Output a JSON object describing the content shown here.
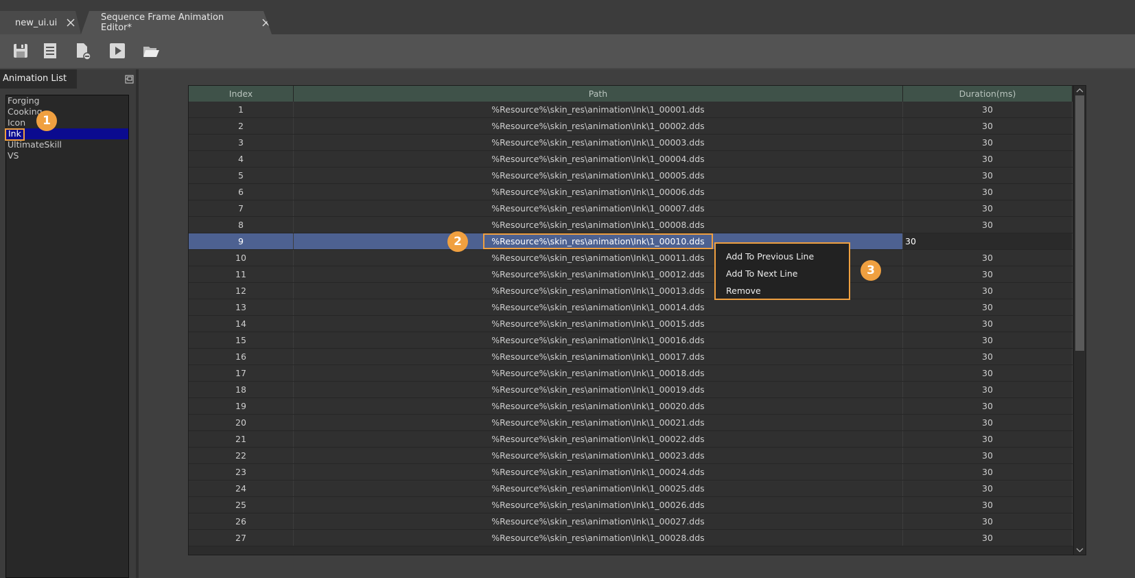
{
  "tabs": [
    {
      "label": "new_ui.ui",
      "close_icon": "close-icon"
    },
    {
      "label": "Sequence Frame Animation Editor*",
      "close_icon": "close-icon"
    }
  ],
  "toolbar": {
    "buttons": [
      {
        "icon": "save-icon"
      },
      {
        "icon": "list-icon"
      },
      {
        "icon": "file-remove-icon"
      },
      {
        "icon": "play-icon"
      },
      {
        "icon": "folder-open-icon"
      }
    ]
  },
  "animation_list": {
    "title": "Animation List",
    "items": [
      "Forging",
      "Cooking",
      "Icon",
      "Ink",
      "UltimateSkill",
      "VS"
    ],
    "selected": "Ink"
  },
  "table": {
    "headers": [
      "Index",
      "Path",
      "Duration(ms)"
    ],
    "rows": [
      {
        "index": "1",
        "path": "%Resource%\\skin_res\\animation\\Ink\\1_00001.dds",
        "duration": "30"
      },
      {
        "index": "2",
        "path": "%Resource%\\skin_res\\animation\\Ink\\1_00002.dds",
        "duration": "30"
      },
      {
        "index": "3",
        "path": "%Resource%\\skin_res\\animation\\Ink\\1_00003.dds",
        "duration": "30"
      },
      {
        "index": "4",
        "path": "%Resource%\\skin_res\\animation\\Ink\\1_00004.dds",
        "duration": "30"
      },
      {
        "index": "5",
        "path": "%Resource%\\skin_res\\animation\\Ink\\1_00005.dds",
        "duration": "30"
      },
      {
        "index": "6",
        "path": "%Resource%\\skin_res\\animation\\Ink\\1_00006.dds",
        "duration": "30"
      },
      {
        "index": "7",
        "path": "%Resource%\\skin_res\\animation\\Ink\\1_00007.dds",
        "duration": "30"
      },
      {
        "index": "8",
        "path": "%Resource%\\skin_res\\animation\\Ink\\1_00008.dds",
        "duration": "30"
      },
      {
        "index": "9",
        "path": "%Resource%\\skin_res\\animation\\Ink\\1_00010.dds",
        "duration": "30"
      },
      {
        "index": "10",
        "path": "%Resource%\\skin_res\\animation\\Ink\\1_00011.dds",
        "duration": "30"
      },
      {
        "index": "11",
        "path": "%Resource%\\skin_res\\animation\\Ink\\1_00012.dds",
        "duration": "30"
      },
      {
        "index": "12",
        "path": "%Resource%\\skin_res\\animation\\Ink\\1_00013.dds",
        "duration": "30"
      },
      {
        "index": "13",
        "path": "%Resource%\\skin_res\\animation\\Ink\\1_00014.dds",
        "duration": "30"
      },
      {
        "index": "14",
        "path": "%Resource%\\skin_res\\animation\\Ink\\1_00015.dds",
        "duration": "30"
      },
      {
        "index": "15",
        "path": "%Resource%\\skin_res\\animation\\Ink\\1_00016.dds",
        "duration": "30"
      },
      {
        "index": "16",
        "path": "%Resource%\\skin_res\\animation\\Ink\\1_00017.dds",
        "duration": "30"
      },
      {
        "index": "17",
        "path": "%Resource%\\skin_res\\animation\\Ink\\1_00018.dds",
        "duration": "30"
      },
      {
        "index": "18",
        "path": "%Resource%\\skin_res\\animation\\Ink\\1_00019.dds",
        "duration": "30"
      },
      {
        "index": "19",
        "path": "%Resource%\\skin_res\\animation\\Ink\\1_00020.dds",
        "duration": "30"
      },
      {
        "index": "20",
        "path": "%Resource%\\skin_res\\animation\\Ink\\1_00021.dds",
        "duration": "30"
      },
      {
        "index": "21",
        "path": "%Resource%\\skin_res\\animation\\Ink\\1_00022.dds",
        "duration": "30"
      },
      {
        "index": "22",
        "path": "%Resource%\\skin_res\\animation\\Ink\\1_00023.dds",
        "duration": "30"
      },
      {
        "index": "23",
        "path": "%Resource%\\skin_res\\animation\\Ink\\1_00024.dds",
        "duration": "30"
      },
      {
        "index": "24",
        "path": "%Resource%\\skin_res\\animation\\Ink\\1_00025.dds",
        "duration": "30"
      },
      {
        "index": "25",
        "path": "%Resource%\\skin_res\\animation\\Ink\\1_00026.dds",
        "duration": "30"
      },
      {
        "index": "26",
        "path": "%Resource%\\skin_res\\animation\\Ink\\1_00027.dds",
        "duration": "30"
      },
      {
        "index": "27",
        "path": "%Resource%\\skin_res\\animation\\Ink\\1_00028.dds",
        "duration": "30"
      }
    ],
    "selected_index": "9"
  },
  "context_menu": {
    "items": [
      "Add To Previous Line",
      "Add To Next Line",
      "Remove"
    ]
  },
  "callouts": [
    "1",
    "2",
    "3"
  ],
  "colors": {
    "accent_orange": "#f0a040",
    "selected_row": "#4d6191",
    "selected_list_item": "#0b0b8f",
    "header_bg": "#3f5249"
  }
}
